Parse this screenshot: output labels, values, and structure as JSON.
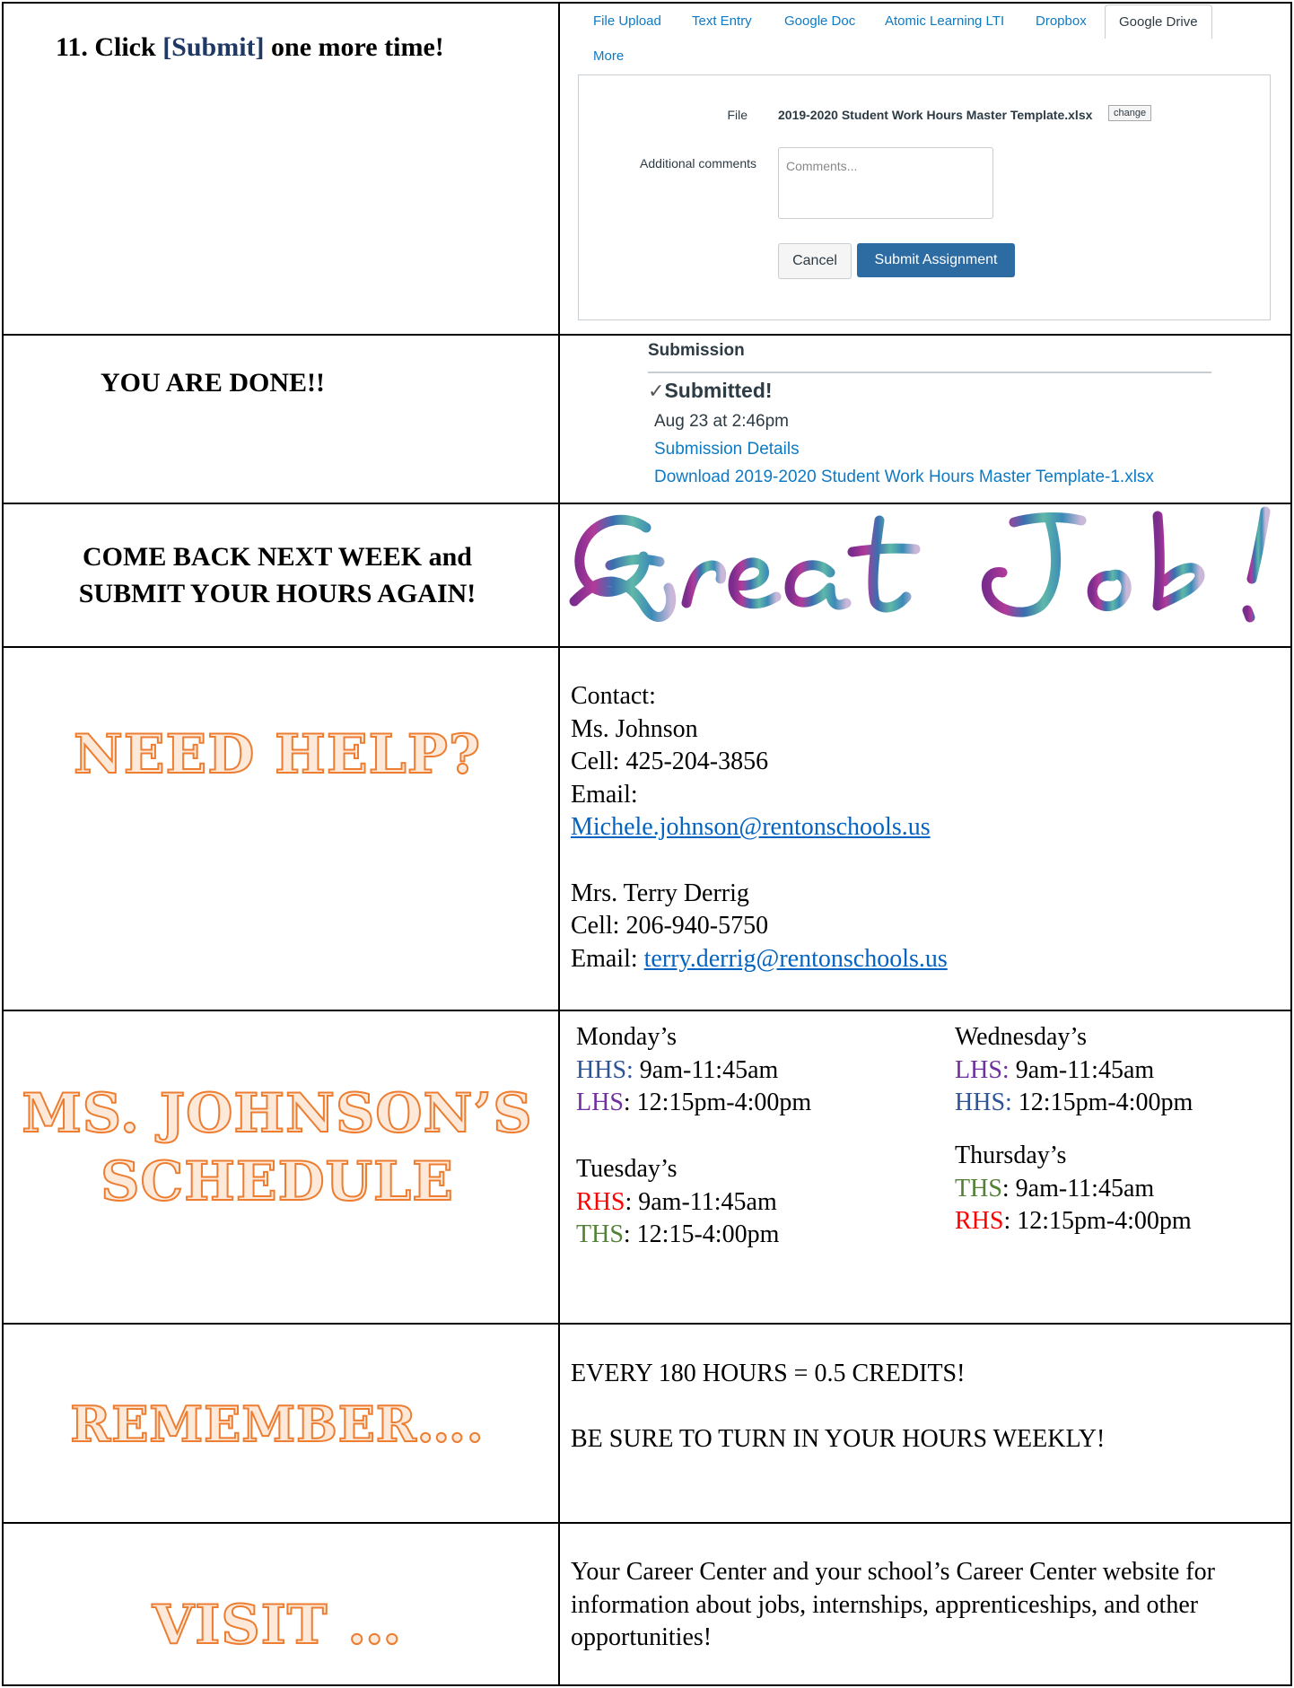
{
  "step": {
    "prefix": "11. Click ",
    "highlight": "[Submit]",
    "suffix": " one more time!"
  },
  "submission_ui": {
    "tabs": [
      "File Upload",
      "Text Entry",
      "Google Doc",
      "Atomic Learning LTI",
      "Dropbox",
      "Google Drive",
      "More"
    ],
    "active_tab": "Google Drive",
    "file_label": "File",
    "file_name": "2019-2020 Student Work Hours Master Template.xlsx",
    "change_label": "change",
    "comments_label": "Additional comments",
    "comments_placeholder": "Comments...",
    "cancel_label": "Cancel",
    "submit_label": "Submit Assignment"
  },
  "done": {
    "text": "YOU ARE DONE!!"
  },
  "submission_status": {
    "heading": "Submission",
    "check": "✓",
    "status": "Submitted!",
    "date": "Aug 23 at 2:46pm",
    "details_link": "Submission Details",
    "download_link": "Download 2019-2020 Student Work Hours Master Template-1.xlsx"
  },
  "come_back": {
    "line1": "COME BACK NEXT WEEK and",
    "line2": "SUBMIT YOUR HOURS AGAIN!"
  },
  "great_job": {
    "colors": [
      "#7b2d8e",
      "#b23a9a",
      "#3a6fb0",
      "#5fb8a8",
      "#8fd4c0",
      "#c9b8d8"
    ]
  },
  "help": {
    "title": "NEED HELP?",
    "contact_label": "Contact:",
    "c1_name": "Ms. Johnson",
    "c1_cell": "Cell: 425-204-3856",
    "c1_email_label": "Email:",
    "c1_email": "Michele.johnson@rentonschools.us",
    "c2_name": "Mrs. Terry Derrig",
    "c2_cell": "Cell: 206-940-5750",
    "c2_email_label": "Email: ",
    "c2_email": "terry.derrig@rentonschools.us"
  },
  "schedule": {
    "title_line1": "MS. JOHNSON’S",
    "title_line2": "SCHEDULE",
    "monday": {
      "day": "Monday’s",
      "s1": "HHS:",
      "t1": " 9am-11:45am",
      "s2": "LHS",
      "t2": ": 12:15pm-4:00pm"
    },
    "tuesday": {
      "day": "Tuesday’s",
      "s1": "RHS",
      "t1": ": 9am-11:45am",
      "s2": "THS",
      "t2": ": 12:15-4:00pm"
    },
    "wednesday": {
      "day": "Wednesday’s",
      "s1": "LHS:",
      "t1": " 9am-11:45am",
      "s2": "HHS:",
      "t2": " 12:15pm-4:00pm"
    },
    "thursday": {
      "day": "Thursday’s",
      "s1": "THS",
      "t1": ": 9am-11:45am",
      "s2": "RHS",
      "t2": ": 12:15pm-4:00pm"
    },
    "colors": {
      "HHS": "#2f5496",
      "LHS": "#7030a0",
      "RHS": "#ff0000",
      "THS": "#538135"
    }
  },
  "remember": {
    "title": "REMEMBER….",
    "line1": "EVERY 180 HOURS = 0.5 CREDITS!",
    "line2": "BE SURE TO TURN IN YOUR HOURS WEEKLY!"
  },
  "visit": {
    "title": "VISIT …",
    "text": "Your Career Center and your school’s Career Center website for information about jobs, internships, apprenticeships, and other opportunities!"
  }
}
